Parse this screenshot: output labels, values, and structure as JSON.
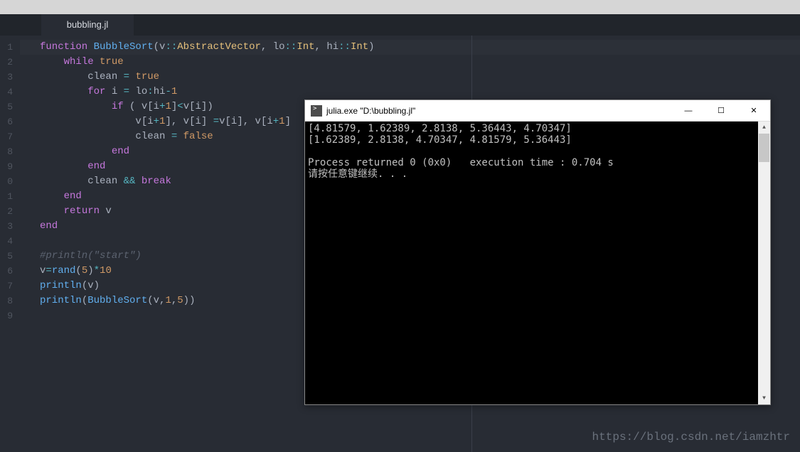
{
  "tab": {
    "filename": "bubbling.jl"
  },
  "editor": {
    "line_count": 19,
    "current_line": 1,
    "lines": [
      [
        {
          "c": "kw",
          "t": "function"
        },
        {
          "c": "id",
          "t": " "
        },
        {
          "c": "fn",
          "t": "BubbleSort"
        },
        {
          "c": "br",
          "t": "("
        },
        {
          "c": "id",
          "t": "v"
        },
        {
          "c": "op",
          "t": "::"
        },
        {
          "c": "ty",
          "t": "AbstractVector"
        },
        {
          "c": "id",
          "t": ", lo"
        },
        {
          "c": "op",
          "t": "::"
        },
        {
          "c": "ty",
          "t": "Int"
        },
        {
          "c": "id",
          "t": ", hi"
        },
        {
          "c": "op",
          "t": "::"
        },
        {
          "c": "ty",
          "t": "Int"
        },
        {
          "c": "br",
          "t": ")"
        }
      ],
      [
        {
          "c": "id",
          "t": "    "
        },
        {
          "c": "kw",
          "t": "while"
        },
        {
          "c": "id",
          "t": " "
        },
        {
          "c": "bool",
          "t": "true"
        }
      ],
      [
        {
          "c": "id",
          "t": "        clean "
        },
        {
          "c": "op",
          "t": "="
        },
        {
          "c": "id",
          "t": " "
        },
        {
          "c": "bool",
          "t": "true"
        }
      ],
      [
        {
          "c": "id",
          "t": "        "
        },
        {
          "c": "kw",
          "t": "for"
        },
        {
          "c": "id",
          "t": " i "
        },
        {
          "c": "op",
          "t": "="
        },
        {
          "c": "id",
          "t": " lo"
        },
        {
          "c": "op",
          "t": ":"
        },
        {
          "c": "id",
          "t": "hi"
        },
        {
          "c": "op",
          "t": "-"
        },
        {
          "c": "num",
          "t": "1"
        }
      ],
      [
        {
          "c": "id",
          "t": "            "
        },
        {
          "c": "kw",
          "t": "if"
        },
        {
          "c": "id",
          "t": " "
        },
        {
          "c": "br",
          "t": "("
        },
        {
          "c": "id",
          "t": " v"
        },
        {
          "c": "br",
          "t": "["
        },
        {
          "c": "id",
          "t": "i"
        },
        {
          "c": "op",
          "t": "+"
        },
        {
          "c": "num",
          "t": "1"
        },
        {
          "c": "br",
          "t": "]"
        },
        {
          "c": "op",
          "t": "<"
        },
        {
          "c": "id",
          "t": "v"
        },
        {
          "c": "br",
          "t": "["
        },
        {
          "c": "id",
          "t": "i"
        },
        {
          "c": "br",
          "t": "])"
        }
      ],
      [
        {
          "c": "id",
          "t": "                v"
        },
        {
          "c": "br",
          "t": "["
        },
        {
          "c": "id",
          "t": "i"
        },
        {
          "c": "op",
          "t": "+"
        },
        {
          "c": "num",
          "t": "1"
        },
        {
          "c": "br",
          "t": "]"
        },
        {
          "c": "id",
          "t": ", v"
        },
        {
          "c": "br",
          "t": "["
        },
        {
          "c": "id",
          "t": "i"
        },
        {
          "c": "br",
          "t": "]"
        },
        {
          "c": "id",
          "t": " "
        },
        {
          "c": "op",
          "t": "="
        },
        {
          "c": "id",
          "t": "v"
        },
        {
          "c": "br",
          "t": "["
        },
        {
          "c": "id",
          "t": "i"
        },
        {
          "c": "br",
          "t": "]"
        },
        {
          "c": "id",
          "t": ", v"
        },
        {
          "c": "br",
          "t": "["
        },
        {
          "c": "id",
          "t": "i"
        },
        {
          "c": "op",
          "t": "+"
        },
        {
          "c": "num",
          "t": "1"
        },
        {
          "c": "br",
          "t": "]"
        }
      ],
      [
        {
          "c": "id",
          "t": "                clean "
        },
        {
          "c": "op",
          "t": "="
        },
        {
          "c": "id",
          "t": " "
        },
        {
          "c": "bool",
          "t": "false"
        }
      ],
      [
        {
          "c": "id",
          "t": "            "
        },
        {
          "c": "kw",
          "t": "end"
        }
      ],
      [
        {
          "c": "id",
          "t": "        "
        },
        {
          "c": "kw",
          "t": "end"
        }
      ],
      [
        {
          "c": "id",
          "t": "        clean "
        },
        {
          "c": "op",
          "t": "&&"
        },
        {
          "c": "id",
          "t": " "
        },
        {
          "c": "kw",
          "t": "break"
        }
      ],
      [
        {
          "c": "id",
          "t": "    "
        },
        {
          "c": "kw",
          "t": "end"
        }
      ],
      [
        {
          "c": "id",
          "t": "    "
        },
        {
          "c": "kw",
          "t": "return"
        },
        {
          "c": "id",
          "t": " v"
        }
      ],
      [
        {
          "c": "kw",
          "t": "end"
        }
      ],
      [],
      [
        {
          "c": "cmt",
          "t": "#println(\"start\")"
        }
      ],
      [
        {
          "c": "id",
          "t": "v"
        },
        {
          "c": "op",
          "t": "="
        },
        {
          "c": "fn",
          "t": "rand"
        },
        {
          "c": "br",
          "t": "("
        },
        {
          "c": "num",
          "t": "5"
        },
        {
          "c": "br",
          "t": ")"
        },
        {
          "c": "op",
          "t": "*"
        },
        {
          "c": "num",
          "t": "10"
        }
      ],
      [
        {
          "c": "fn",
          "t": "println"
        },
        {
          "c": "br",
          "t": "("
        },
        {
          "c": "id",
          "t": "v"
        },
        {
          "c": "br",
          "t": ")"
        }
      ],
      [
        {
          "c": "fn",
          "t": "println"
        },
        {
          "c": "br",
          "t": "("
        },
        {
          "c": "fn",
          "t": "BubbleSort"
        },
        {
          "c": "br",
          "t": "("
        },
        {
          "c": "id",
          "t": "v,"
        },
        {
          "c": "num",
          "t": "1"
        },
        {
          "c": "id",
          "t": ","
        },
        {
          "c": "num",
          "t": "5"
        },
        {
          "c": "br",
          "t": "))"
        }
      ],
      []
    ]
  },
  "console": {
    "title": "julia.exe \"D:\\bubbling.jl\"",
    "output_line1": "[4.81579, 1.62389, 2.8138, 5.36443, 4.70347]",
    "output_line2": "[1.62389, 2.8138, 4.70347, 4.81579, 5.36443]",
    "blank": "",
    "process_line": "Process returned 0 (0x0)   execution time : 0.704 s",
    "press_key": "请按任意键继续. . ."
  },
  "watermark": "https://blog.csdn.net/iamzhtr"
}
